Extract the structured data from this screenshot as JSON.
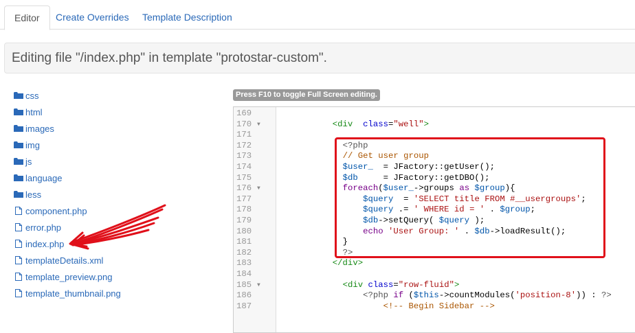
{
  "tabs": [
    {
      "label": "Editor",
      "active": true
    },
    {
      "label": "Create Overrides",
      "active": false
    },
    {
      "label": "Template Description",
      "active": false
    }
  ],
  "header": {
    "title": "Editing file \"/index.php\" in template \"protostar-custom\"."
  },
  "tree": [
    {
      "label": "css",
      "type": "folder-icon"
    },
    {
      "label": "html",
      "type": "folder-icon"
    },
    {
      "label": "images",
      "type": "folder-icon"
    },
    {
      "label": "img",
      "type": "folder-icon"
    },
    {
      "label": "js",
      "type": "folder-icon"
    },
    {
      "label": "language",
      "type": "folder-icon"
    },
    {
      "label": "less",
      "type": "folder-icon"
    },
    {
      "label": "component.php",
      "type": "file-icon"
    },
    {
      "label": "error.php",
      "type": "file-icon"
    },
    {
      "label": "index.php",
      "type": "file-icon"
    },
    {
      "label": "templateDetails.xml",
      "type": "file-icon"
    },
    {
      "label": "template_preview.png",
      "type": "file-icon"
    },
    {
      "label": "template_thumbnail.png",
      "type": "file-icon"
    }
  ],
  "editor": {
    "hint": "Press F10 to toggle Full Screen editing.",
    "lines": [
      {
        "n": "169",
        "fold": false,
        "indent": "",
        "tokens": []
      },
      {
        "n": "170",
        "fold": true,
        "indent": "          ",
        "tokens": [
          [
            "tag",
            "<div"
          ],
          [
            "",
            "  "
          ],
          [
            "attr",
            "class"
          ],
          [
            "",
            "="
          ],
          [
            "str",
            "\"well\""
          ],
          [
            "tag",
            ">"
          ]
        ]
      },
      {
        "n": "171",
        "fold": false,
        "indent": "",
        "tokens": []
      },
      {
        "n": "172",
        "fold": false,
        "indent": "            ",
        "tokens": [
          [
            "php",
            "<?php"
          ]
        ]
      },
      {
        "n": "173",
        "fold": false,
        "indent": "            ",
        "tokens": [
          [
            "cmt",
            "// Get user group"
          ]
        ]
      },
      {
        "n": "174",
        "fold": false,
        "indent": "            ",
        "tokens": [
          [
            "var",
            "$user_"
          ],
          [
            "",
            "  = JFactory::getUser();"
          ]
        ]
      },
      {
        "n": "175",
        "fold": false,
        "indent": "            ",
        "tokens": [
          [
            "var",
            "$db"
          ],
          [
            "",
            "     = JFactory::getDBO();"
          ]
        ]
      },
      {
        "n": "176",
        "fold": true,
        "indent": "            ",
        "tokens": [
          [
            "kw",
            "foreach"
          ],
          [
            "",
            "("
          ],
          [
            "var",
            "$user_"
          ],
          [
            "",
            "->groups "
          ],
          [
            "kw",
            "as"
          ],
          [
            "",
            ""
          ],
          [
            "var",
            " $group"
          ],
          [
            "",
            "){"
          ]
        ]
      },
      {
        "n": "177",
        "fold": false,
        "indent": "                ",
        "tokens": [
          [
            "var",
            "$query"
          ],
          [
            "",
            "  = "
          ],
          [
            "str",
            "'SELECT title FROM #__usergroups'"
          ],
          [
            "",
            ";"
          ]
        ]
      },
      {
        "n": "178",
        "fold": false,
        "indent": "                ",
        "tokens": [
          [
            "var",
            "$query"
          ],
          [
            "",
            " .= "
          ],
          [
            "str",
            "' WHERE id = '"
          ],
          [
            "",
            " . "
          ],
          [
            "var",
            "$group"
          ],
          [
            "",
            ";"
          ]
        ]
      },
      {
        "n": "179",
        "fold": false,
        "indent": "                ",
        "tokens": [
          [
            "var",
            "$db"
          ],
          [
            "",
            "->setQuery( "
          ],
          [
            "var",
            "$query"
          ],
          [
            "",
            " );"
          ]
        ]
      },
      {
        "n": "180",
        "fold": false,
        "indent": "                ",
        "tokens": [
          [
            "kw",
            "echo"
          ],
          [
            "",
            ""
          ],
          [
            "str",
            " 'User Group: '"
          ],
          [
            "",
            " . "
          ],
          [
            "var",
            "$db"
          ],
          [
            "",
            "->loadResult();"
          ]
        ]
      },
      {
        "n": "181",
        "fold": false,
        "indent": "            ",
        "tokens": [
          [
            "",
            "}"
          ]
        ]
      },
      {
        "n": "182",
        "fold": false,
        "indent": "            ",
        "tokens": [
          [
            "php",
            "?>"
          ]
        ]
      },
      {
        "n": "183",
        "fold": false,
        "indent": "          ",
        "tokens": [
          [
            "tag",
            "</div>"
          ]
        ]
      },
      {
        "n": "184",
        "fold": false,
        "indent": "",
        "tokens": []
      },
      {
        "n": "185",
        "fold": true,
        "indent": "            ",
        "tokens": [
          [
            "tag",
            "<div"
          ],
          [
            "",
            " "
          ],
          [
            "attr",
            "class"
          ],
          [
            "",
            "="
          ],
          [
            "str",
            "\"row-fluid\""
          ],
          [
            "tag",
            ">"
          ]
        ]
      },
      {
        "n": "186",
        "fold": false,
        "indent": "                ",
        "tokens": [
          [
            "php",
            "<?php"
          ],
          [
            "",
            " "
          ],
          [
            "kw",
            "if"
          ],
          [
            "",
            " ("
          ],
          [
            "var",
            "$this"
          ],
          [
            "",
            "->countModules("
          ],
          [
            "str",
            "'position-8'"
          ],
          [
            "",
            ")) : "
          ],
          [
            "php",
            "?>"
          ]
        ]
      },
      {
        "n": "187",
        "fold": false,
        "indent": "                    ",
        "tokens": [
          [
            "cmt",
            "<!-- Begin Sidebar -->"
          ]
        ]
      }
    ]
  },
  "colors": {
    "link": "#2a69b8",
    "highlight": "#e0101a",
    "arrow": "#e0101a"
  }
}
